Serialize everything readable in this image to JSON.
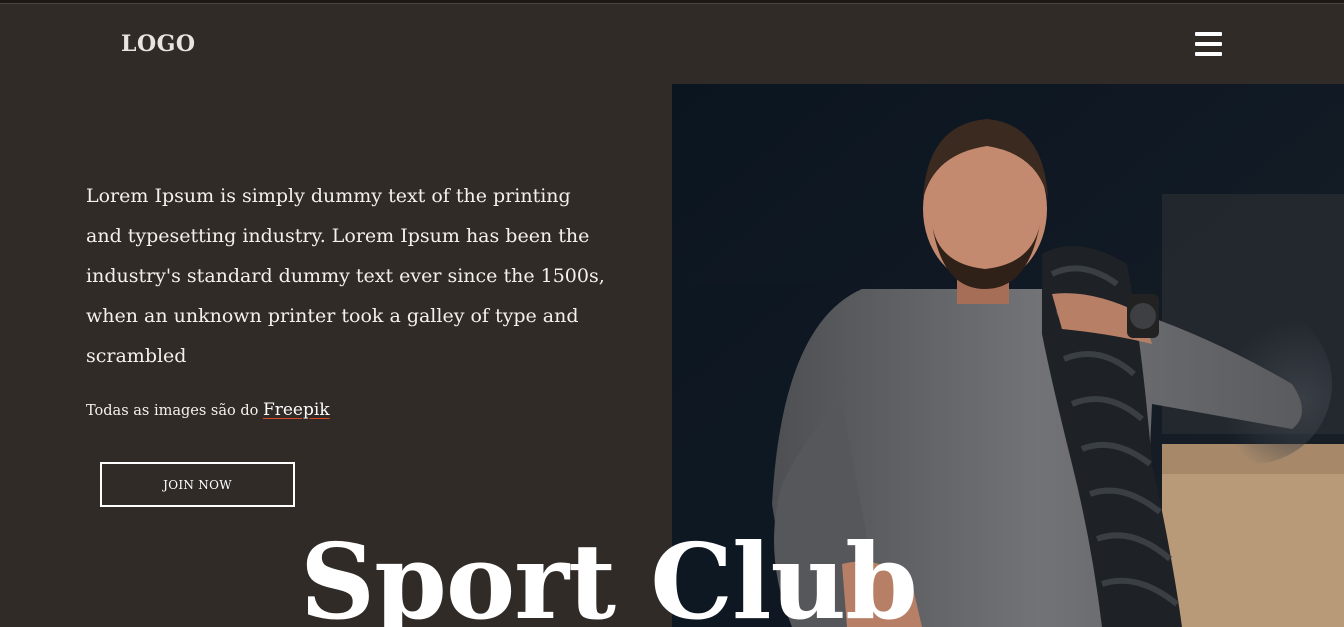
{
  "header": {
    "logo": "LOGO",
    "menu_icon": "hamburger-menu-icon"
  },
  "hero": {
    "description": "Lorem Ipsum is simply dummy text of the printing and typesetting industry. Lorem Ipsum has been the industry's standard dummy text ever since the 1500s, when an unknown printer took a galley of type and scrambled",
    "credit_prefix": "Todas as images são do",
    "credit_link": "Freepik",
    "cta_label": "JOIN NOW",
    "title": "Sport Club",
    "image_subject": "athlete-with-battle-rope"
  },
  "colors": {
    "background": "#312b28",
    "text": "#ffffff",
    "link_underline": "#d64a2a"
  }
}
